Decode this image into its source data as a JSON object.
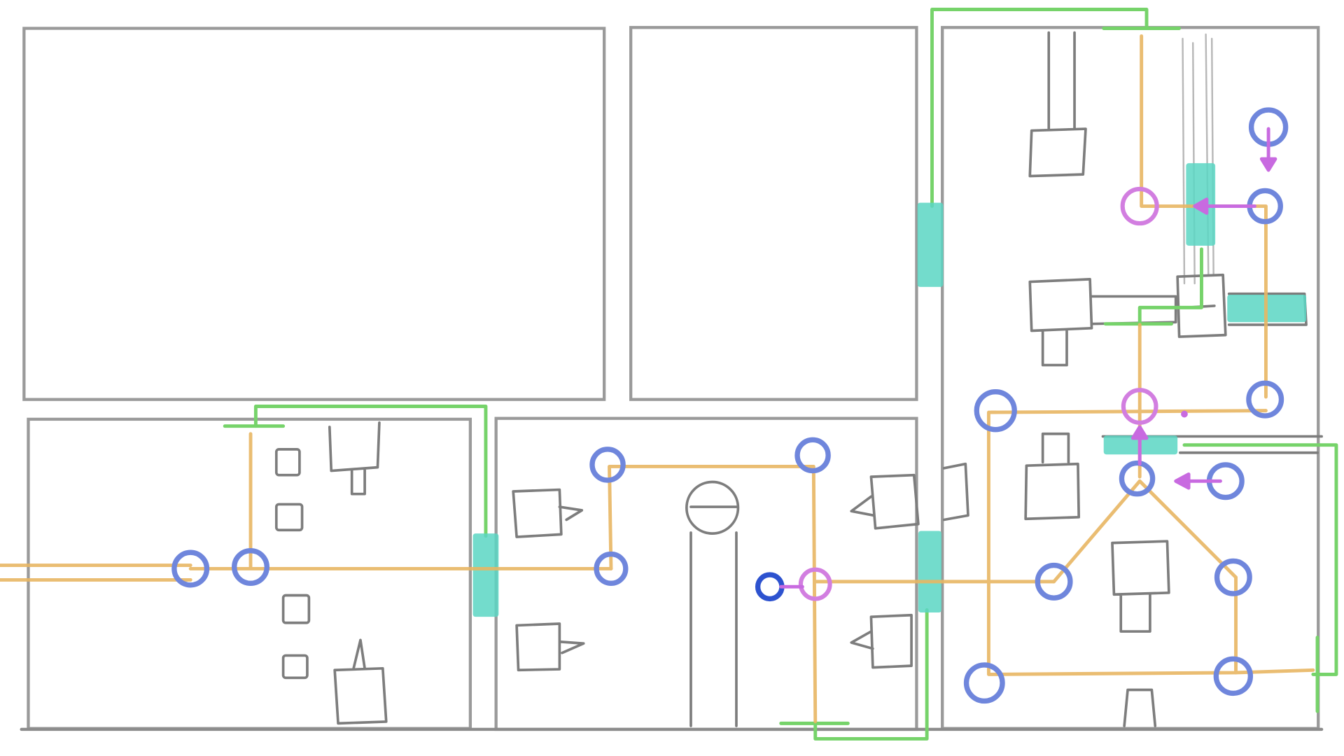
{
  "diagram": {
    "kind": "floor-plan-sketch",
    "colors": {
      "background": "#ffffff",
      "wall": "#9a9a9a",
      "wall_dark": "#8c8c8c",
      "furniture": "#7d7d7d",
      "path": "#e8b663",
      "node_blue": "#6f86dc",
      "node_blue_dark": "#2d52cf",
      "node_magenta": "#d27ee0",
      "arrow_magenta": "#c86ae0",
      "green_line": "#76d36a",
      "door_teal": "#5ad6c3"
    },
    "icons": {
      "node_blue": "blue-ring-node-icon",
      "node_magenta": "magenta-ring-node-icon",
      "arrow": "magenta-arrow-icon",
      "door": "teal-door-marker-icon"
    },
    "labels": []
  }
}
